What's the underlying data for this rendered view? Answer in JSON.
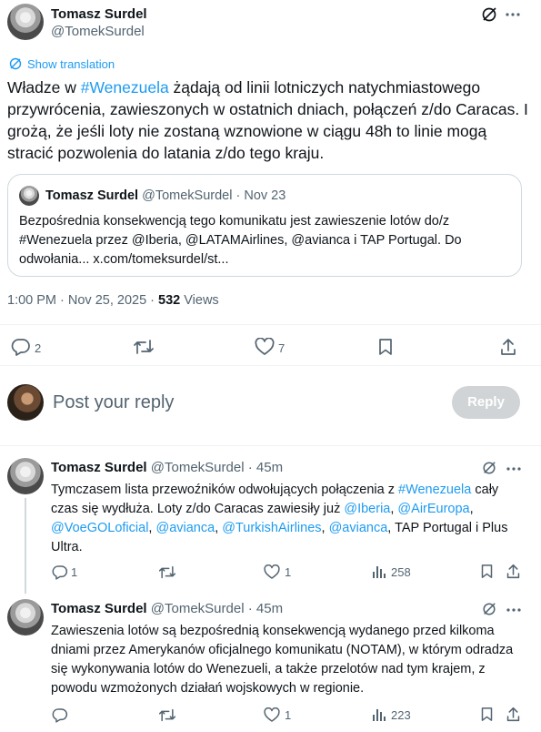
{
  "main_tweet": {
    "author_name": "Tomasz Surdel",
    "author_handle": "@TomekSurdel",
    "show_translation": "Show translation",
    "text_parts": [
      "Władze w ",
      "#Wenezuela",
      " żądają od linii lotniczych natychmiastowego przywrócenia, zawieszonych w ostatnich dniach, połączeń z/do Caracas. I grożą, że jeśli loty nie zostaną wznowione w ciągu 48h to linie mogą stracić pozwolenia do latania z/do tego kraju."
    ],
    "quote": {
      "author_name": "Tomasz Surdel",
      "author_handle": "@TomekSurdel",
      "separator": "·",
      "date": "Nov 23",
      "text": "Bezpośrednia konsekwencją tego komunikatu jest zawieszenie lotów do/z #Wenezuela przez @Iberia, @LATAMAirlines, @avianca i TAP Portugal. Do odwołania... x.com/tomeksurdel/st..."
    },
    "timestamp": "1:00 PM · Nov 25, 2025 · ",
    "views_count": "532",
    "views_label": " Views",
    "replies": "2",
    "reposts": "",
    "likes": "7"
  },
  "compose": {
    "placeholder": "Post your reply",
    "reply_button": "Reply"
  },
  "replies": [
    {
      "author_name": "Tomasz Surdel",
      "author_handle": "@TomekSurdel",
      "age": "· 45m",
      "text_parts": [
        {
          "t": "Tymczasem lista przewoźników odwołujących połączenia z ",
          "link": false
        },
        {
          "t": "#Wenezuela",
          "link": true
        },
        {
          "t": " cały czas się wydłuża. Loty z/do Caracas zawiesiły już ",
          "link": false
        },
        {
          "t": "@Iberia",
          "link": true
        },
        {
          "t": ", ",
          "link": false
        },
        {
          "t": "@AirEuropa",
          "link": true
        },
        {
          "t": ", ",
          "link": false
        },
        {
          "t": "@VoeGOLoficial",
          "link": true
        },
        {
          "t": ", ",
          "link": false
        },
        {
          "t": "@avianca",
          "link": true
        },
        {
          "t": ", ",
          "link": false
        },
        {
          "t": "@TurkishAirlines",
          "link": true
        },
        {
          "t": ", ",
          "link": false
        },
        {
          "t": "@avianca",
          "link": true
        },
        {
          "t": ", TAP Portugal i Plus Ultra.",
          "link": false
        }
      ],
      "replies": "1",
      "likes": "1",
      "views": "258"
    },
    {
      "author_name": "Tomasz Surdel",
      "author_handle": "@TomekSurdel",
      "age": "· 45m",
      "text": "Zawieszenia lotów są bezpośrednią konsekwencją wydanego przed kilkoma dniami przez Amerykanów oficjalnego komunikatu (NOTAM), w którym odradza się wykonywania lotów do Wenezueli, a także przelotów nad tym krajem, z powodu wzmożonych działań wojskowych w regionie.",
      "replies": "",
      "likes": "1",
      "views": "223"
    }
  ],
  "icons": {
    "grok": "grok-icon",
    "more": "more-icon",
    "translate": "translate-icon",
    "reply": "reply-icon",
    "repost": "repost-icon",
    "like": "like-icon",
    "bookmark": "bookmark-icon",
    "share": "share-icon",
    "views": "views-icon"
  },
  "colors": {
    "link": "#1d9bf0",
    "secondary_text": "#536471",
    "reply_button_bg": "#d0d4d6"
  }
}
